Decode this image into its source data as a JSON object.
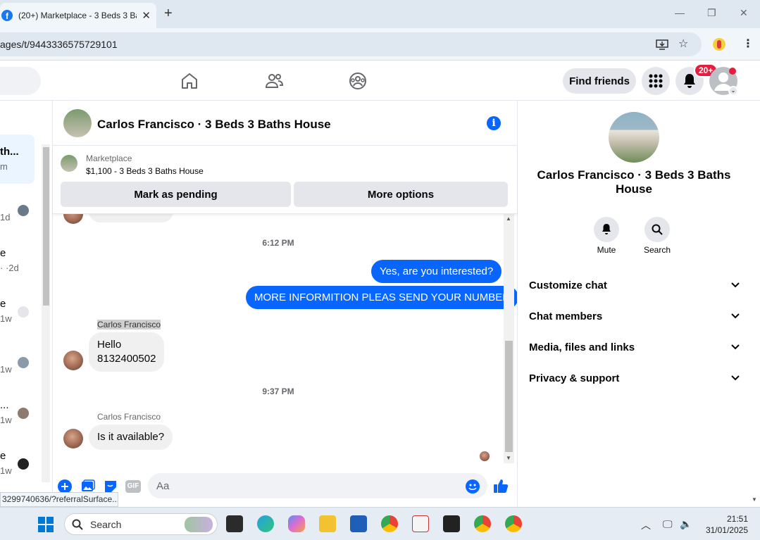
{
  "browser": {
    "tab_title": "(20+) Marketplace - 3 Beds 3 Ba",
    "url": "ages/t/9443336575729101",
    "status_url": "3299740636/?referralSurface..."
  },
  "nav": {
    "find_friends": "Find friends",
    "notification_badge": "20+"
  },
  "conversation_list": {
    "items": [
      {
        "title": "th...",
        "sub": "m"
      },
      {
        "title": "",
        "sub": "1d"
      },
      {
        "title": "e",
        "sub": "· ·2d"
      },
      {
        "title": "e",
        "sub": "1w"
      },
      {
        "title": "",
        "sub": "1w"
      },
      {
        "title": "...",
        "sub": "1w"
      },
      {
        "title": "e",
        "sub": "1w"
      }
    ]
  },
  "chat": {
    "title": "Carlos Francisco · 3 Beds 3 Baths House",
    "marketplace_label": "Marketplace",
    "listing": "$1,100 - 3 Beds 3 Baths House",
    "mark_pending": "Mark as pending",
    "more_options": "More options",
    "timestamp1": "6:12 PM",
    "out_msg1": "Yes, are you interested?",
    "out_msg2": "MORE INFORMITION PLEAS SEND YOUR NUMBER",
    "sender1": "Carlos Francisco",
    "in_msg1_line1": "Hello",
    "in_msg1_line2": "8132400502",
    "timestamp2": "9:37 PM",
    "sender2": "Carlos Francisco",
    "in_msg2": "Is it available?",
    "composer_placeholder": "Aa"
  },
  "details": {
    "title": "Carlos Francisco · 3 Beds 3 Baths House",
    "mute": "Mute",
    "search": "Search",
    "sections": [
      "Customize chat",
      "Chat members",
      "Media, files and links",
      "Privacy & support"
    ]
  },
  "taskbar": {
    "search_label": "Search",
    "time": "21:51",
    "date": "31/01/2025"
  },
  "colors": {
    "brand_blue": "#0866ff",
    "badge_red": "#e41e3f"
  }
}
